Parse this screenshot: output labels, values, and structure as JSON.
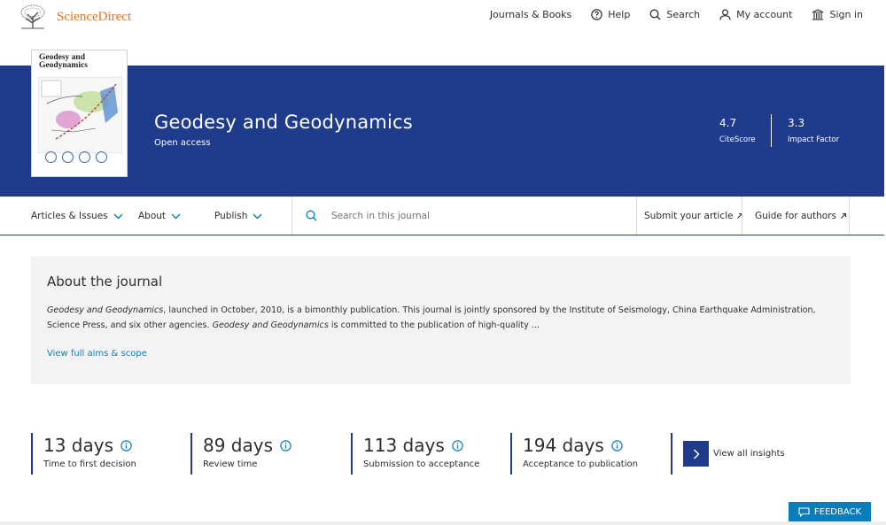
{
  "header": {
    "brand": "ScienceDirect",
    "nav": [
      {
        "label": "Journals & Books",
        "icon": null
      },
      {
        "label": "Help",
        "icon": "help-circle-icon"
      },
      {
        "label": "Search",
        "icon": "search-icon"
      },
      {
        "label": "My account",
        "icon": "person-icon"
      },
      {
        "label": "Sign in",
        "icon": "institution-icon"
      }
    ]
  },
  "banner": {
    "title": "Geodesy and Geodynamics",
    "access": "Open access",
    "cover_title_line1": "Geodesy and",
    "cover_title_line2": "Geodynamics",
    "metrics": [
      {
        "value": "4.7",
        "label": "CiteScore"
      },
      {
        "value": "3.3",
        "label": "Impact Factor"
      }
    ],
    "colors": {
      "banner": "#1f3c8c",
      "brand": "#e9711c"
    }
  },
  "subnav": {
    "items": [
      "Articles & Issues",
      "About",
      "Publish"
    ],
    "search_placeholder": "Search in this journal",
    "links": [
      "Submit your article",
      "Guide for authors"
    ]
  },
  "about": {
    "heading": "About the journal",
    "journal_name": "Geodesy and Geodynamics",
    "text1": ", launched in October, 2010, is a bimonthly publication. This journal is jointly sponsored by the Institute of Seismology, China Earthquake Administration, Science Press, and six other agencies. ",
    "text2": " is committed to the publication of high-quality ...",
    "link": "View full aims & scope"
  },
  "insights": [
    {
      "value": "13 days",
      "label": "Time to first decision"
    },
    {
      "value": "89 days",
      "label": "Review time"
    },
    {
      "value": "113 days",
      "label": "Submission to acceptance"
    },
    {
      "value": "194 days",
      "label": "Acceptance to publication"
    }
  ],
  "insights_link": "View all insights",
  "feedback": "FEEDBACK"
}
